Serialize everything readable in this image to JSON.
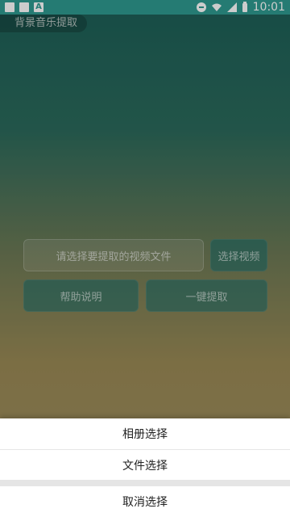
{
  "status_bar": {
    "time": "10:01",
    "icons": [
      "image-icon",
      "square-icon",
      "a-icon",
      "dnd-icon",
      "wifi-icon",
      "signal-icon",
      "battery-icon"
    ]
  },
  "app": {
    "title": "背景音乐提取"
  },
  "main": {
    "file_placeholder": "请选择要提取的视频文件",
    "select_video_button": "选择视频",
    "help_button": "帮助说明",
    "extract_button": "一键提取"
  },
  "bottom_sheet": {
    "album_option": "相册选择",
    "file_option": "文件选择",
    "cancel_option": "取消选择"
  }
}
